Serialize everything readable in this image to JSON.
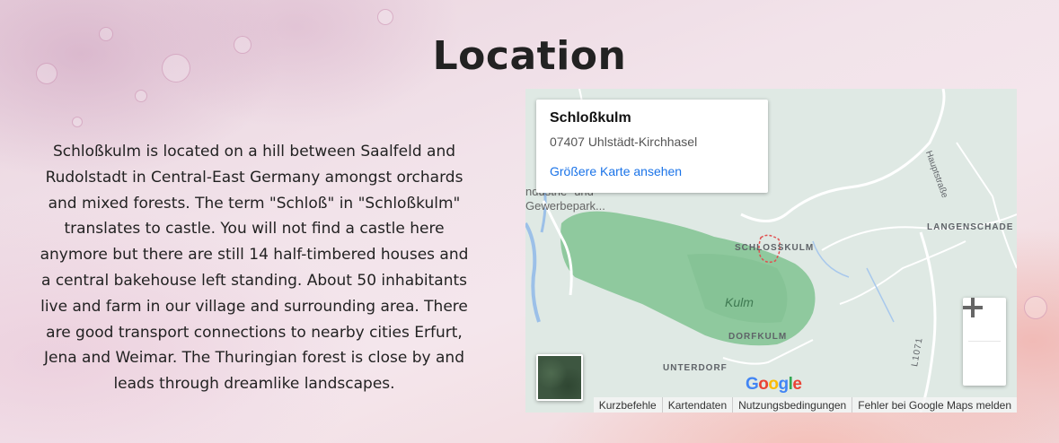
{
  "page": {
    "title": "Location",
    "description": "Schloßkulm is located on a hill between Saalfeld and Rudolstadt in Central-East Germany amongst orchards and mixed forests. The term \"Schloß\" in \"Schloßkulm\" translates to castle. You will not find a castle here anymore but there are still 14 half-timbered houses and a central bakehouse left standing. About 50 inhabitants live and farm in our village and surrounding area. There are good transport connections to nearby cities Erfurt, Jena and Weimar. The Thuringian forest is close by and leads through dreamlike landscapes."
  },
  "map": {
    "info": {
      "name": "Schloßkulm",
      "address": "07407 Uhlstädt-Kirchhasel",
      "larger_map_link": "Größere Karte ansehen"
    },
    "labels": {
      "schlosskulm": "SCHLOSSKULM",
      "langenschade": "LANGENSCHADE",
      "kulm": "Kulm",
      "dorfkulm": "DORFKULM",
      "unterdorf": "UNTERDORF",
      "gewerbepark": "Gewerbepark...",
      "gewerbe_top": "ndustrie- und",
      "haupt": "Hauptstraße",
      "road": "L1071"
    },
    "zoom": {
      "in": "+",
      "out": "−"
    },
    "google_logo": {
      "text": "Google",
      "colors": [
        "#4285F4",
        "#EA4335",
        "#FBBC05",
        "#4285F4",
        "#34A853",
        "#EA4335"
      ]
    },
    "attribution": [
      "Kurzbefehle",
      "Kartendaten",
      "Nutzungsbedingungen",
      "Fehler bei Google Maps melden"
    ]
  }
}
